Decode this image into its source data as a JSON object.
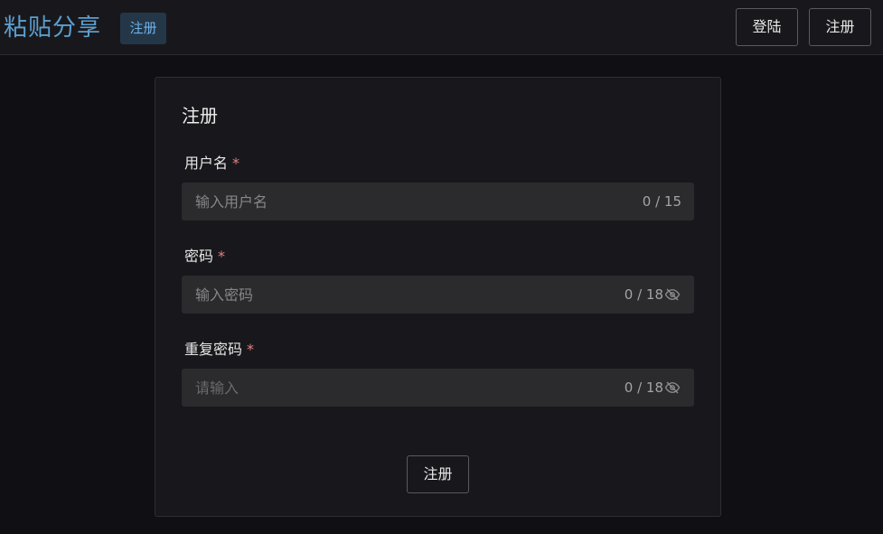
{
  "header": {
    "brand": "粘贴分享",
    "page_tag": "注册",
    "login_label": "登陆",
    "register_label": "注册"
  },
  "form": {
    "title": "注册",
    "required_mark": "*",
    "username": {
      "label": "用户名",
      "placeholder": "输入用户名",
      "value": "",
      "counter": "0 / 15"
    },
    "password": {
      "label": "密码",
      "placeholder": "输入密码",
      "value": "",
      "counter": "0 / 18",
      "icon": "eye-off-icon"
    },
    "confirm_password": {
      "label": "重复密码",
      "placeholder": "请输入",
      "value": "",
      "counter": "0 / 18",
      "icon": "eye-off-icon"
    },
    "submit_label": "注册"
  },
  "colors": {
    "background": "#101014",
    "surface": "#18181c",
    "input_bg": "#2b2b2e",
    "brand": "#5d9fcf",
    "required": "#e88080"
  }
}
